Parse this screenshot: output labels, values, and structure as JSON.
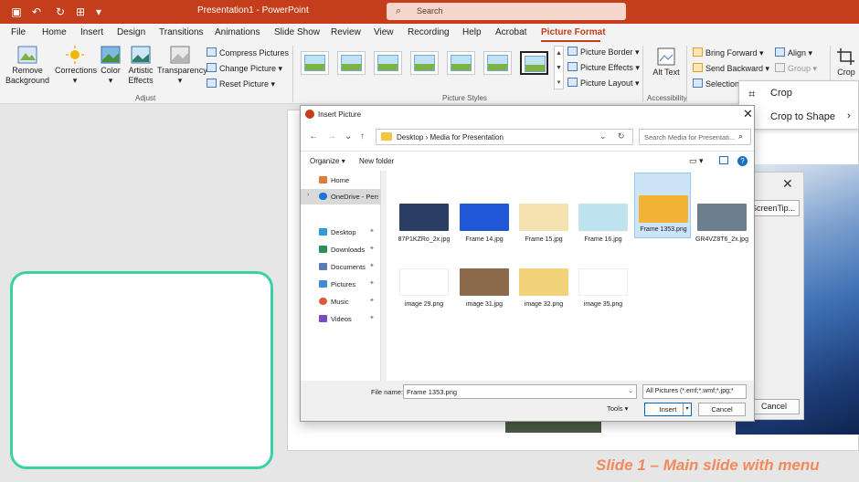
{
  "titlebar": {
    "title": "Presentation1  -  PowerPoint",
    "search_placeholder": "Search"
  },
  "tabs": [
    "File",
    "Home",
    "Insert",
    "Design",
    "Transitions",
    "Animations",
    "Slide Show",
    "Review",
    "View",
    "Recording",
    "Help",
    "Acrobat",
    "Picture Format"
  ],
  "active_tab": "Picture Format",
  "ribbon": {
    "remove_background": "Remove Background",
    "corrections": "Corrections",
    "color": "Color",
    "artistic_effects": "Artistic Effects",
    "transparency": "Transparency",
    "compress_pictures": "Compress Pictures",
    "change_picture": "Change Picture",
    "reset_picture": "Reset Picture",
    "adjust_label": "Adjust",
    "picture_border": "Picture Border",
    "picture_effects": "Picture Effects",
    "picture_layout": "Picture Layout",
    "picture_styles_label": "Picture Styles",
    "alt_text": "Alt Text",
    "accessibility_label": "Accessibility",
    "bring_forward": "Bring Forward",
    "send_backward": "Send Backward",
    "selection_pane": "Selection",
    "align": "Align",
    "group": "Group",
    "crop": "Crop"
  },
  "crop_menu": {
    "crop": "Crop",
    "crop_to_shape": "Crop to Shape"
  },
  "bg_dialog": {
    "screentip": "ScreenTip...",
    "cancel": "Cancel"
  },
  "dialog": {
    "title": "Insert Picture",
    "breadcrumb": "Desktop  ›  Media for Presentation",
    "search_placeholder": "Search Media for Presentati...",
    "organize": "Organize",
    "new_folder": "New folder",
    "nav": [
      {
        "label": "Home",
        "color": "#e07b39"
      },
      {
        "label": "OneDrive - Pers",
        "color": "#1e73d8"
      },
      {
        "label": "Desktop",
        "color": "#2e9bd6"
      },
      {
        "label": "Downloads",
        "color": "#2a8f5a"
      },
      {
        "label": "Documents",
        "color": "#5a7bb5"
      },
      {
        "label": "Pictures",
        "color": "#3f8ad8"
      },
      {
        "label": "Music",
        "color": "#e0583a"
      },
      {
        "label": "Videos",
        "color": "#7a4bc2"
      }
    ],
    "files": [
      {
        "name": "87P1KZRo_2x.jpg",
        "bg": "#2c3d63"
      },
      {
        "name": "Frame 14.jpg",
        "bg": "#1f57d6"
      },
      {
        "name": "Frame 15.jpg",
        "bg": "#f4e3b0"
      },
      {
        "name": "Frame 16.jpg",
        "bg": "#bfe4ef"
      },
      {
        "name": "Frame 1353.png",
        "bg": "#f2b233"
      },
      {
        "name": "GR4VZ8T6_2x.jpg",
        "bg": "#6b7f8c"
      },
      {
        "name": "image 29.png",
        "bg": "#ffffff"
      },
      {
        "name": "image 31.jpg",
        "bg": "#8a6a4a"
      },
      {
        "name": "image 32.png",
        "bg": "#f2d27a"
      },
      {
        "name": "image 35.png",
        "bg": "#ffffff"
      }
    ],
    "file_name_label": "File name:",
    "file_name_value": "Frame 1353.png",
    "filter": "All Pictures (*.emf;*.wmf;*.jpg;*",
    "tools": "Tools",
    "insert": "Insert",
    "cancel": "Cancel"
  },
  "caption": "Slide 1 – Main slide with menu",
  "colors": {
    "accent": "#c43e1c",
    "thumb_border": "#3ad1a6",
    "caption": "#f28a5a"
  }
}
